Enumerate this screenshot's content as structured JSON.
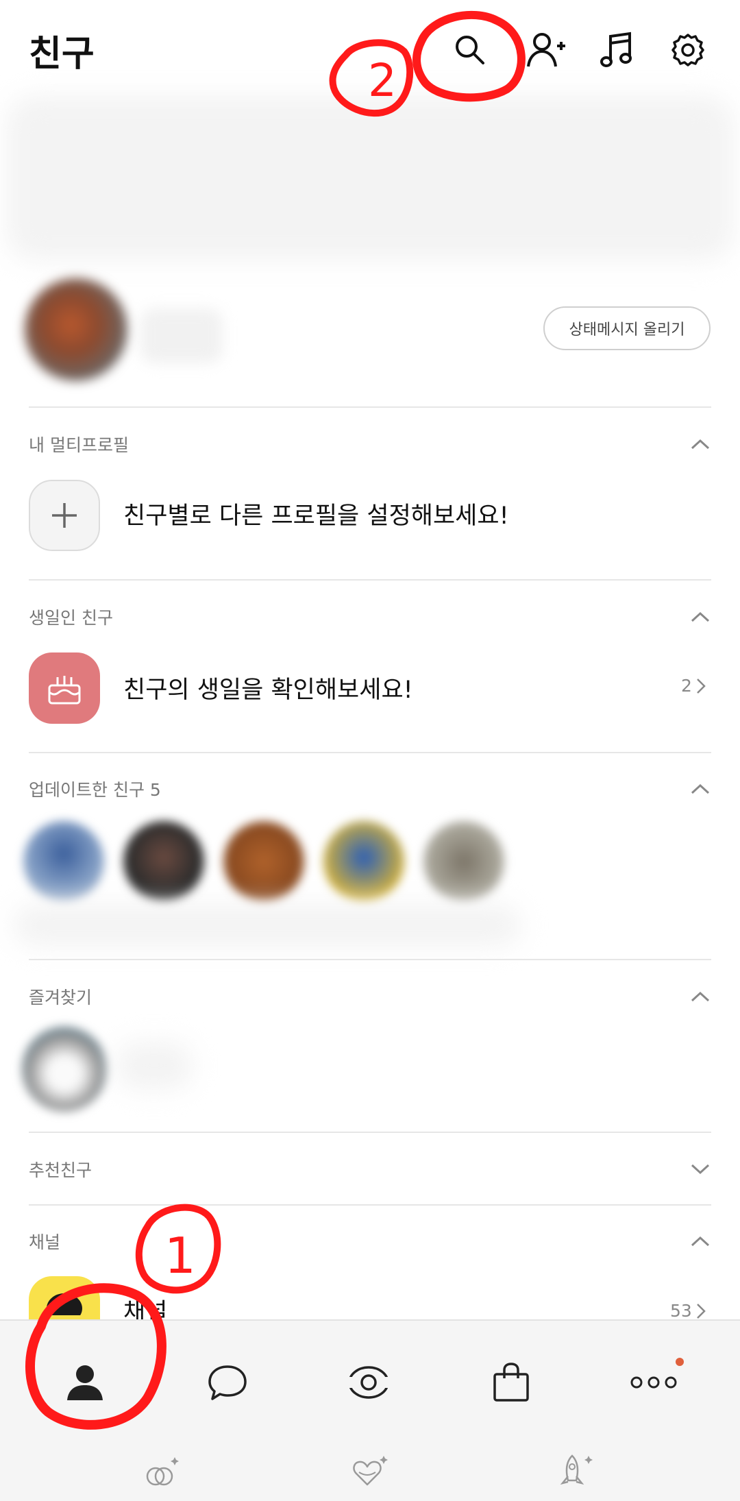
{
  "header": {
    "title": "친구",
    "icons": [
      "search-icon",
      "add-friend-icon",
      "music-icon",
      "settings-icon"
    ]
  },
  "profile": {
    "status_button": "상태메시지 올리기"
  },
  "sections": {
    "multi_profile": {
      "title": "내 멀티프로필",
      "row_text": "친구별로 다른 프로필을 설정해보세요!"
    },
    "birthday": {
      "title": "생일인 친구",
      "row_text": "친구의 생일을 확인해보세요!",
      "count": "2"
    },
    "updated": {
      "title": "업데이트한 친구 5"
    },
    "favorites": {
      "title": "즐겨찾기"
    },
    "recommended": {
      "title": "추천친구"
    },
    "channel": {
      "title": "채널",
      "row_text": "채널",
      "count": "53"
    }
  },
  "bottom_nav": {
    "tabs": [
      "friends-tab",
      "chats-tab",
      "view-tab",
      "shopping-tab",
      "more-tab"
    ],
    "more_badge_color": "#e0603c",
    "sub_icons": [
      "rings-icon",
      "heart-icon",
      "rocket-icon"
    ]
  },
  "annotations": {
    "circle_1_label": "1",
    "circle_2_label": "2",
    "color": "#ff1a1a"
  },
  "colors": {
    "birthday_icon_bg": "#e07a7d",
    "channel_icon_bg": "#f9e14b"
  }
}
